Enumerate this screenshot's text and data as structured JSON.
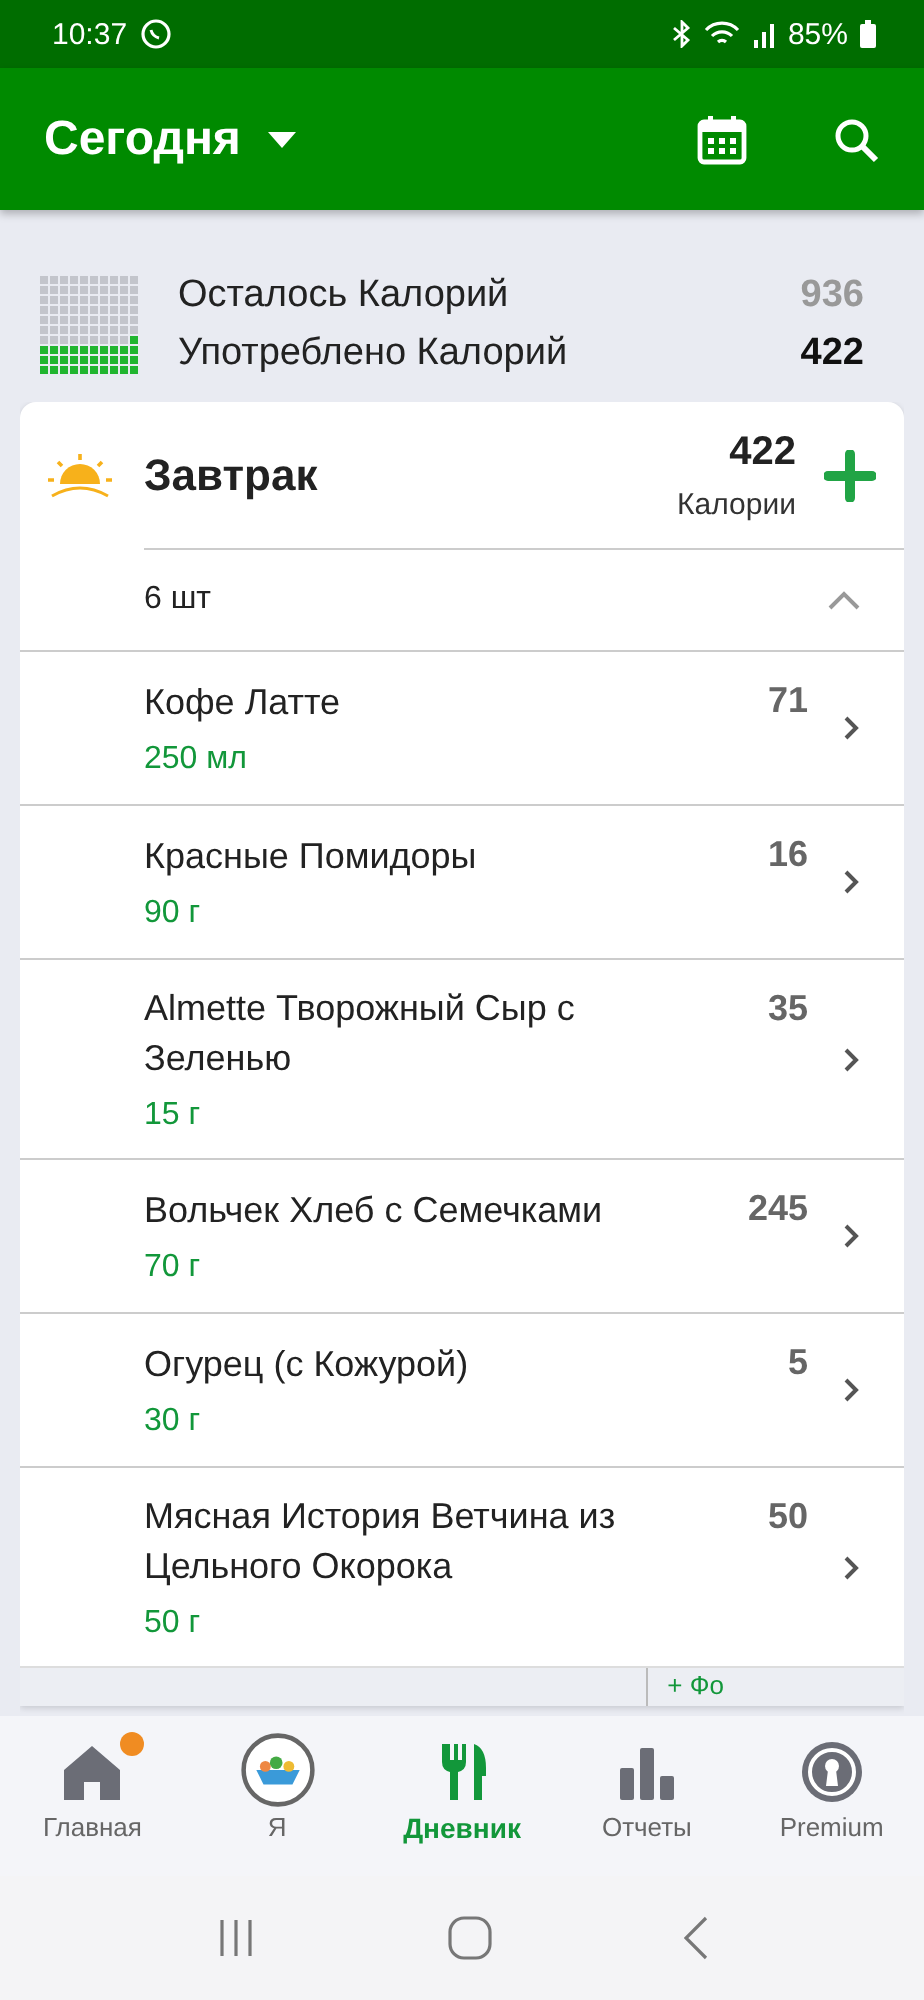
{
  "status_bar": {
    "time": "10:37",
    "battery": "85%"
  },
  "app_bar": {
    "title": "Сегодня"
  },
  "summary": {
    "remaining_label": "Осталось Калорий",
    "remaining": "936",
    "consumed_label": "Употреблено Калорий",
    "consumed": "422"
  },
  "meal": {
    "title": "Завтрак",
    "calories": "422",
    "calories_label": "Калории",
    "count": "6 шт",
    "expanded": true,
    "items": [
      {
        "name": "Кофе Латте",
        "amount": "250 мл",
        "calories": "71"
      },
      {
        "name": "Красные Помидоры",
        "amount": "90 г",
        "calories": "16"
      },
      {
        "name": "Almette Творожный Сыр с Зеленью",
        "amount": "15 г",
        "calories": "35"
      },
      {
        "name": "Вольчек Хлеб с Семечками",
        "amount": "70 г",
        "calories": "245"
      },
      {
        "name": "Огурец (с Кожурой)",
        "amount": "30 г",
        "calories": "5"
      },
      {
        "name": "Мясная История Ветчина из Цельного Окорока",
        "amount": "50 г",
        "calories": "50"
      }
    ],
    "footer_action": "+ Фо"
  },
  "bottom_nav": [
    {
      "kind": "home",
      "label": "Главная",
      "selected": false,
      "badge": true
    },
    {
      "kind": "avatar",
      "label": "Я",
      "selected": false,
      "badge": false
    },
    {
      "kind": "diary",
      "label": "Дневник",
      "selected": true,
      "badge": false
    },
    {
      "kind": "reports",
      "label": "Отчеты",
      "selected": false,
      "badge": false
    },
    {
      "kind": "premium",
      "label": "Premium",
      "selected": false,
      "badge": false
    }
  ]
}
